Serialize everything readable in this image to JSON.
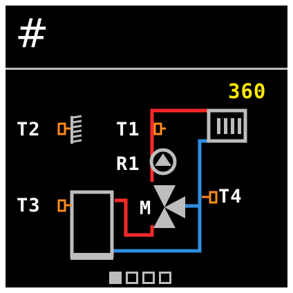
{
  "header": {
    "title": "#"
  },
  "display": {
    "value": "360"
  },
  "sensors": {
    "t1": "T1",
    "t2": "T2",
    "t3": "T3",
    "t4": "T4"
  },
  "components": {
    "pump": "R1",
    "mixer": "M"
  },
  "pagination": {
    "pages": 4,
    "active_index": 0
  },
  "colors": {
    "background": "#000000",
    "supply_pipe": "#ff2a2a",
    "return_pipe": "#2f8ee0",
    "sensor": "#ff8c1a",
    "value": "#ffea00",
    "device": "#bdbdbd"
  },
  "icons": [
    "outdoor-wall-icon",
    "radiator-icon",
    "pump-icon",
    "mixing-valve-icon",
    "boiler-tank-icon",
    "temperature-sensor-icon"
  ]
}
